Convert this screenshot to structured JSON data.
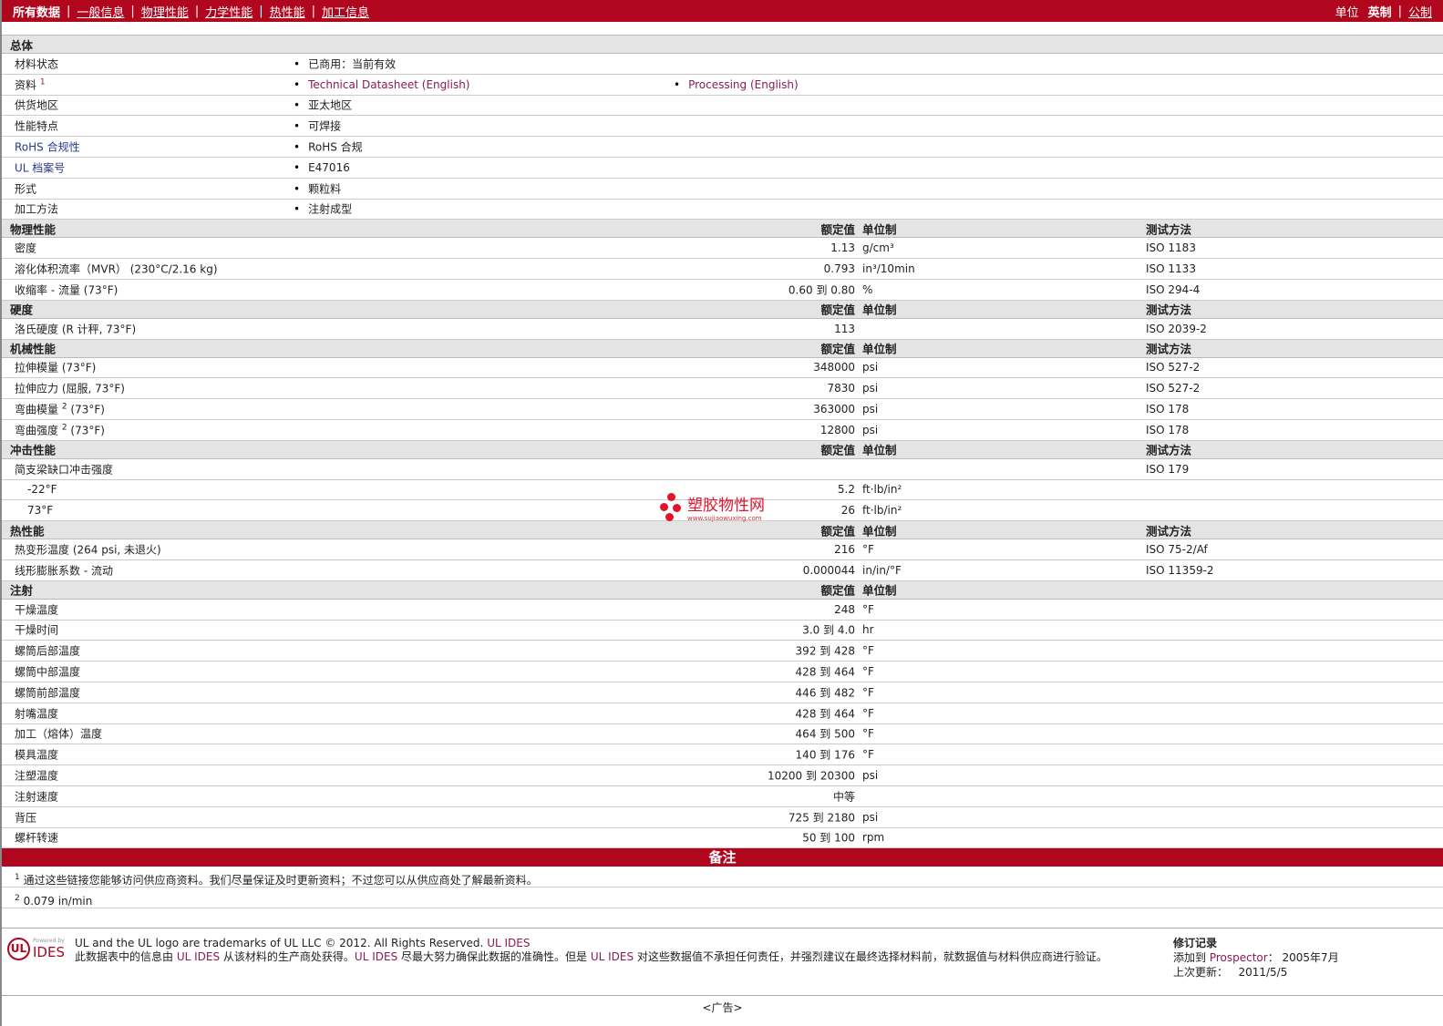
{
  "topbar": {
    "tabs": [
      {
        "label": "所有数据",
        "active": true
      },
      {
        "label": "一般信息"
      },
      {
        "label": "物理性能"
      },
      {
        "label": "力学性能"
      },
      {
        "label": "热性能"
      },
      {
        "label": "加工信息"
      }
    ],
    "units_label": "单位",
    "unit_active": "英制",
    "unit_other": "公制"
  },
  "sections": [
    {
      "title": "总体",
      "headers": null,
      "rows": [
        {
          "name": "材料状态",
          "b1": "已商用：当前有效"
        },
        {
          "name": "资料",
          "sup": "1",
          "b1": "Technical Datasheet (English)",
          "b1link": true,
          "b2": "Processing (English)",
          "b2link": true
        },
        {
          "name": "供货地区",
          "b1": "亚太地区"
        },
        {
          "name": "性能特点",
          "b1": "可焊接"
        },
        {
          "name": "RoHS 合规性",
          "namelink": true,
          "b1": "RoHS 合规"
        },
        {
          "name": "UL 档案号",
          "namelink": true,
          "b1": "E47016"
        },
        {
          "name": "形式",
          "b1": "颗粒料"
        },
        {
          "name": "加工方法",
          "b1": "注射成型"
        }
      ]
    },
    {
      "title": "物理性能",
      "headers": {
        "value": "额定值",
        "unit": "单位制",
        "method": "测试方法"
      },
      "rows": [
        {
          "name": "密度",
          "value": "1.13",
          "unit": "g/cm³",
          "method": "ISO 1183"
        },
        {
          "name": "溶化体积流率（MVR） (230°C/2.16 kg)",
          "value": "0.793",
          "unit": "in³/10min",
          "method": "ISO 1133"
        },
        {
          "name": "收缩率 - 流量 (73°F)",
          "value": "0.60 到  0.80",
          "unit": "%",
          "method": "ISO 294-4"
        }
      ]
    },
    {
      "title": "硬度",
      "headers": {
        "value": "额定值",
        "unit": "单位制",
        "method": "测试方法"
      },
      "rows": [
        {
          "name": "洛氏硬度 (R 计秤, 73°F)",
          "value": "113",
          "unit": "",
          "method": "ISO 2039-2"
        }
      ]
    },
    {
      "title": "机械性能",
      "headers": {
        "value": "额定值",
        "unit": "单位制",
        "method": "测试方法"
      },
      "rows": [
        {
          "name": "拉伸模量 (73°F)",
          "value": "348000",
          "unit": "psi",
          "method": "ISO 527-2"
        },
        {
          "name": "拉伸应力 (屈服, 73°F)",
          "value": "7830",
          "unit": "psi",
          "method": "ISO 527-2"
        },
        {
          "name": "弯曲模量",
          "sup": "2",
          "suffix": " (73°F)",
          "value": "363000",
          "unit": "psi",
          "method": "ISO 178"
        },
        {
          "name": "弯曲强度",
          "sup": "2",
          "suffix": " (73°F)",
          "value": "12800",
          "unit": "psi",
          "method": "ISO 178"
        }
      ]
    },
    {
      "title": "冲击性能",
      "headers": {
        "value": "额定值",
        "unit": "单位制",
        "method": "测试方法"
      },
      "rows": [
        {
          "name": "简支梁缺口冲击强度",
          "value": "",
          "unit": "",
          "method": "ISO 179"
        },
        {
          "name": "-22°F",
          "indent": true,
          "value": "5.2",
          "unit": "ft·lb/in²"
        },
        {
          "name": "73°F",
          "indent": true,
          "value": "26",
          "unit": "ft·lb/in²"
        }
      ]
    },
    {
      "title": "热性能",
      "headers": {
        "value": "额定值",
        "unit": "单位制",
        "method": "测试方法"
      },
      "rows": [
        {
          "name": "热变形温度 (264 psi, 未退火)",
          "value": "216",
          "unit": "°F",
          "method": "ISO 75-2/Af"
        },
        {
          "name": "线形膨胀系数 - 流动",
          "value": "0.000044",
          "unit": "in/in/°F",
          "method": "ISO 11359-2"
        }
      ]
    },
    {
      "title": "注射",
      "headers": {
        "value": "额定值",
        "unit": "单位制",
        "method": ""
      },
      "rows": [
        {
          "name": "干燥温度",
          "value": "248",
          "unit": "°F"
        },
        {
          "name": "干燥时间",
          "value": "3.0 到  4.0",
          "unit": "hr"
        },
        {
          "name": "螺筒后部温度",
          "value": "392 到  428",
          "unit": "°F"
        },
        {
          "name": "螺筒中部温度",
          "value": "428 到  464",
          "unit": "°F"
        },
        {
          "name": "螺筒前部温度",
          "value": "446 到  482",
          "unit": "°F"
        },
        {
          "name": "射嘴温度",
          "value": "428 到  464",
          "unit": "°F"
        },
        {
          "name": "加工（熔体）温度",
          "value": "464 到  500",
          "unit": "°F"
        },
        {
          "name": "模具温度",
          "value": "140 到  176",
          "unit": "°F"
        },
        {
          "name": "注塑温度",
          "value": "10200 到  20300",
          "unit": "psi"
        },
        {
          "name": "注射速度",
          "value": "中等",
          "unit": ""
        },
        {
          "name": "背压",
          "value": "725 到  2180",
          "unit": "psi"
        },
        {
          "name": "螺杆转速",
          "value": "50 到  100",
          "unit": "rpm"
        }
      ]
    }
  ],
  "notes": {
    "title": "备注",
    "items": [
      {
        "sup": "1",
        "text": "通过这些链接您能够访问供应商资料。我们尽量保证及时更新资料；不过您可以从供应商处了解最新资料。"
      },
      {
        "sup": "2",
        "text": "0.079 in/min"
      }
    ]
  },
  "footer": {
    "logo_top": "Powered by",
    "logo_ul": "UL",
    "logo_ides": "IDES",
    "line1": "UL and the UL logo are trademarks of UL LLC © 2012. All Rights Reserved.",
    "line1_link": "UL IDES",
    "line2_a": "此数据表中的信息由 ",
    "line2_link1": "UL IDES",
    "line2_b": " 从该材料的生产商处获得。",
    "line2_link2": "UL IDES",
    "line2_c": " 尽最大努力确保此数据的准确性。但是 ",
    "line2_link3": "UL IDES",
    "line2_d": " 对这些数据值不承担任何责任，并强烈建议在最终选择材料前，就数据值与材料供应商进行验证。",
    "rev_title": "修订记录",
    "rev_added_label": "添加到 ",
    "rev_added_link": "Prospector",
    "rev_added_value": "：   2005年7月",
    "rev_updated_label": "上次更新：",
    "rev_updated_value": "2011/5/5"
  },
  "ad": "<广告>",
  "watermark": {
    "text": "塑胶物性网",
    "url": "www.sujiaowuxing.com"
  },
  "colors": {
    "brand_red": "#b0061e",
    "link": "#8a1a55",
    "section_bg": "#e4e4e4"
  }
}
